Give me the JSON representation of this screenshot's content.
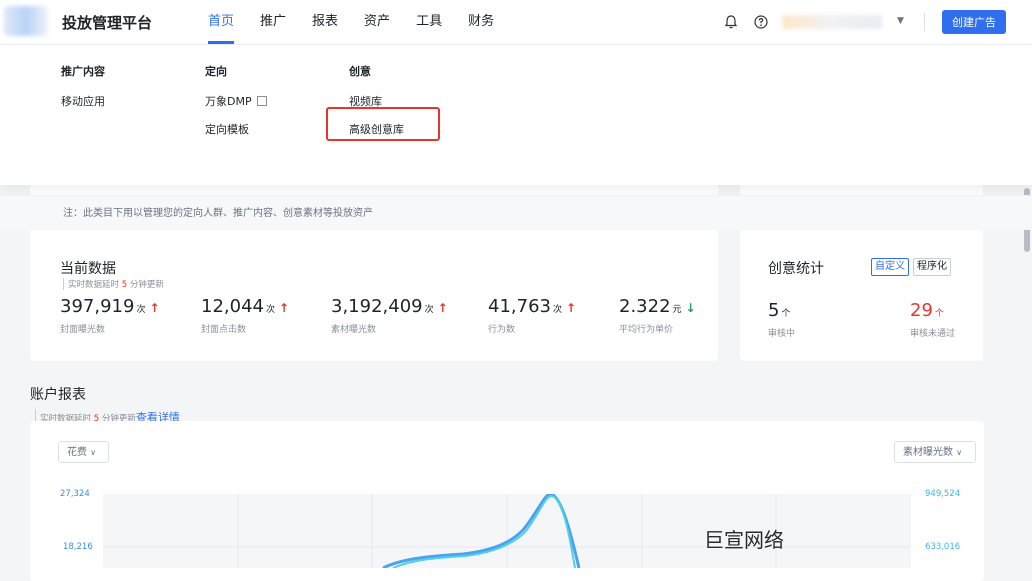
{
  "header": {
    "app_title": "投放管理平台",
    "nav": [
      {
        "label": "首页",
        "active": true
      },
      {
        "label": "推广"
      },
      {
        "label": "报表"
      },
      {
        "label": "资产"
      },
      {
        "label": "工具"
      },
      {
        "label": "财务"
      }
    ],
    "icons": [
      "bell-icon",
      "help-icon"
    ],
    "create_button": "创建广告"
  },
  "menu": {
    "columns": [
      {
        "title": "推广内容",
        "links": [
          "移动应用"
        ]
      },
      {
        "title": "定向",
        "links": [
          "万象DMP",
          "定向模板"
        ]
      },
      {
        "title": "创意",
        "links": [
          "视频库",
          "高级创意库"
        ]
      }
    ],
    "highlighted": "高级创意库",
    "note": "注：此类目下用以管理您的定向人群、推广内容、创意素材等投放资产"
  },
  "current_data": {
    "title": "当前数据",
    "sub_prefix": "实时数据延时",
    "sub_num": "5",
    "sub_suffix": "分钟更新",
    "metrics": [
      {
        "value": "397,919",
        "unit": "次",
        "trend": "↑",
        "label": "封面曝光数"
      },
      {
        "value": "12,044",
        "unit": "次",
        "trend": "↑",
        "label": "封面点击数"
      },
      {
        "value": "3,192,409",
        "unit": "次",
        "trend": "↑",
        "label": "素材曝光数"
      },
      {
        "value": "41,763",
        "unit": "次",
        "trend": "↑",
        "label": "行为数"
      },
      {
        "value": "2.322",
        "unit": "元",
        "trend": "↓",
        "label": "平均行为单价"
      }
    ]
  },
  "creative_stats": {
    "title": "创意统计",
    "tags": [
      "自定义",
      "程序化"
    ],
    "items": [
      {
        "value": "5",
        "unit": "个",
        "label": "审核中"
      },
      {
        "value": "29",
        "unit": "个",
        "label": "审核未通过"
      }
    ]
  },
  "account_report": {
    "title": "账户报表",
    "sub_prefix": "实时数据延时",
    "sub_num": "5",
    "sub_suffix": "分钟更新",
    "link": "查看详情",
    "left_select": "花费",
    "right_select": "素材曝光数",
    "left_ticks": [
      "27,324",
      "18,216"
    ],
    "right_ticks": [
      "949,524",
      "633,016"
    ],
    "watermark": "巨宣网络"
  },
  "colors": {
    "accent": "#2f6fed",
    "up": "#e4372b",
    "down": "#19a05b"
  }
}
